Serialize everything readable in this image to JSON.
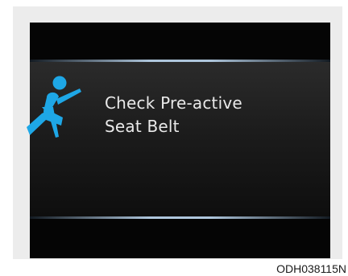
{
  "display": {
    "message_line1": "Check Pre-active",
    "message_line2": "Seat Belt",
    "icon": "seat-belt-warning-icon",
    "icon_color": "#1ea7e6",
    "text_color": "#e9e9e9",
    "band_color": "#aec6dc"
  },
  "figure_code": "ODH038115N"
}
